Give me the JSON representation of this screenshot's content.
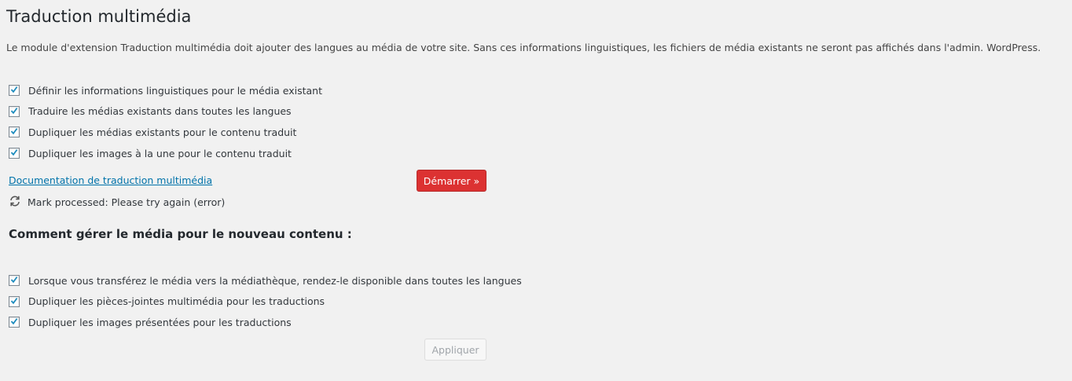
{
  "page": {
    "title": "Traduction multimédia",
    "description": "Le module d'extension Traduction multimédia doit ajouter des langues au média de votre site. Sans ces informations linguistiques, les fichiers de média existants ne seront pas affichés dans l'admin. WordPress."
  },
  "existing_media_options": [
    {
      "label": "Définir les informations linguistiques pour le média existant",
      "checked": true
    },
    {
      "label": "Traduire les médias existants dans toutes les langues",
      "checked": true
    },
    {
      "label": "Dupliquer les médias existants pour le contenu traduit",
      "checked": true
    },
    {
      "label": "Dupliquer les images à la une pour le contenu traduit",
      "checked": true
    }
  ],
  "documentation_link": "Documentation de traduction multimédia",
  "start_button": "Démarrer »",
  "status": {
    "icon": "refresh-icon",
    "text": "Mark processed: Please try again (error)"
  },
  "new_content": {
    "heading": "Comment gérer le média pour le nouveau contenu :",
    "options": [
      {
        "label": "Lorsque vous transférez le média vers la médiathèque, rendez-le disponible dans toutes les langues",
        "checked": true
      },
      {
        "label": "Dupliquer les pièces-jointes multimédia pour les traductions",
        "checked": true
      },
      {
        "label": "Dupliquer les images présentées pour les traductions",
        "checked": true
      }
    ],
    "apply_button": "Appliquer"
  },
  "colors": {
    "background": "#f1f1f1",
    "link": "#0073aa",
    "start_button": "#dc3232",
    "checkmark": "#1e8cbe"
  }
}
